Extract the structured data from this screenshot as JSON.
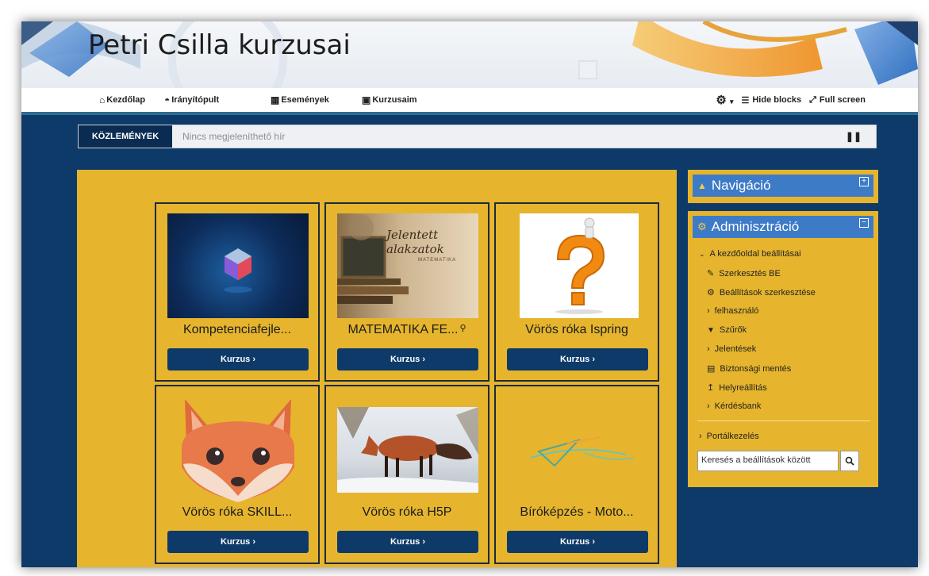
{
  "header": {
    "site_title": "Petri Csilla kurzusai"
  },
  "nav": {
    "items": [
      {
        "label": "Kezdőlap",
        "icon": "home-icon"
      },
      {
        "label": "Irányítópult",
        "icon": "dashboard-icon"
      },
      {
        "label": "Események",
        "icon": "calendar-icon"
      },
      {
        "label": "Kurzusaim",
        "icon": "briefcase-icon"
      }
    ],
    "hide_blocks": "Hide blocks",
    "full_screen": "Full screen"
  },
  "news": {
    "label": "KÖZLEMÉNYEK",
    "text": "Nincs megjeleníthető hír",
    "pause": "❚❚"
  },
  "courses": [
    {
      "title": "Kompetenciafejle...",
      "button": "Kurzus ›"
    },
    {
      "title": "MATEMATIKA FE...",
      "button": "Kurzus ›",
      "thumb_script": "Jelentett alakzatok",
      "thumb_caption": "MATEMATIKA"
    },
    {
      "title": "Vörös róka Ispring",
      "button": "Kurzus ›"
    },
    {
      "title": "Vörös róka SKILL...",
      "button": "Kurzus ›"
    },
    {
      "title": "Vörös róka H5P",
      "button": "Kurzus ›"
    },
    {
      "title": "Bíróképzés - Moto...",
      "button": "Kurzus ›"
    }
  ],
  "nav_block": {
    "title": "Navigáció"
  },
  "admin_block": {
    "title": "Adminisztráció",
    "items": [
      {
        "label": "A kezdőoldal beállításai",
        "icon": "chevron-down-icon"
      },
      {
        "label": "Szerkesztés BE",
        "icon": "pencil-icon"
      },
      {
        "label": "Beállítások szerkesztése",
        "icon": "gear-icon"
      },
      {
        "label": "felhasználó",
        "icon": "chevron-right-icon"
      },
      {
        "label": "Szűrők",
        "icon": "filter-icon"
      },
      {
        "label": "Jelentések",
        "icon": "chevron-right-icon"
      },
      {
        "label": "Biztonsági mentés",
        "icon": "backup-icon"
      },
      {
        "label": "Helyreállítás",
        "icon": "restore-icon"
      },
      {
        "label": "Kérdésbank",
        "icon": "chevron-right-icon"
      }
    ],
    "site_admin": "Portálkezelés",
    "search_placeholder": "Keresés a beállítások között"
  },
  "colors": {
    "page_bg": "#0e3a69",
    "card_yellow": "#e6b52d",
    "button_blue": "#0e3a69",
    "block_header": "#3d7bc7"
  }
}
